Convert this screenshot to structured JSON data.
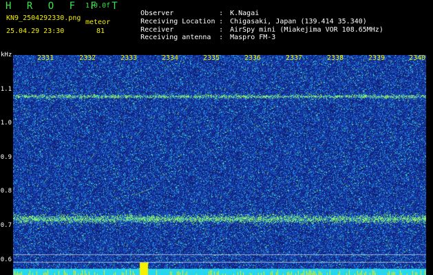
{
  "header": {
    "title": "H R O F F T",
    "version": "1.0.0f",
    "filename": "KN9_2504292330.png",
    "datetime": "25.04.29 23:30",
    "meteor_label": "meteor",
    "meteor_count": "81"
  },
  "meta": [
    {
      "key": "Observer",
      "sep": ":",
      "value": "K.Nagai"
    },
    {
      "key": "Receiving Location",
      "sep": ":",
      "value": "Chigasaki, Japan (139.414 35.340)"
    },
    {
      "key": "Receiver",
      "sep": ":",
      "value": "AirSpy mini (Miakejima VOR 108.65MHz)"
    },
    {
      "key": "Receiving antenna",
      "sep": ":",
      "value": "Maspro FM-3"
    }
  ],
  "axis": {
    "unit": "kHz",
    "y_ticks": [
      "1.1",
      "1.0",
      "0.9",
      "0.8",
      "0.7",
      "0.6"
    ],
    "x_ticks": [
      "2331",
      "2332",
      "2333",
      "2334",
      "2335",
      "2336",
      "2337",
      "2338",
      "2339",
      "2340"
    ]
  },
  "colors": {
    "background": "#000000",
    "noise_base": "#10207a",
    "noise_mid": "#1c5fd0",
    "noise_hi": "#21c8e8",
    "signal": "#7ef06a",
    "label_yellow": "#f4f000",
    "label_green": "#39e84a"
  }
}
